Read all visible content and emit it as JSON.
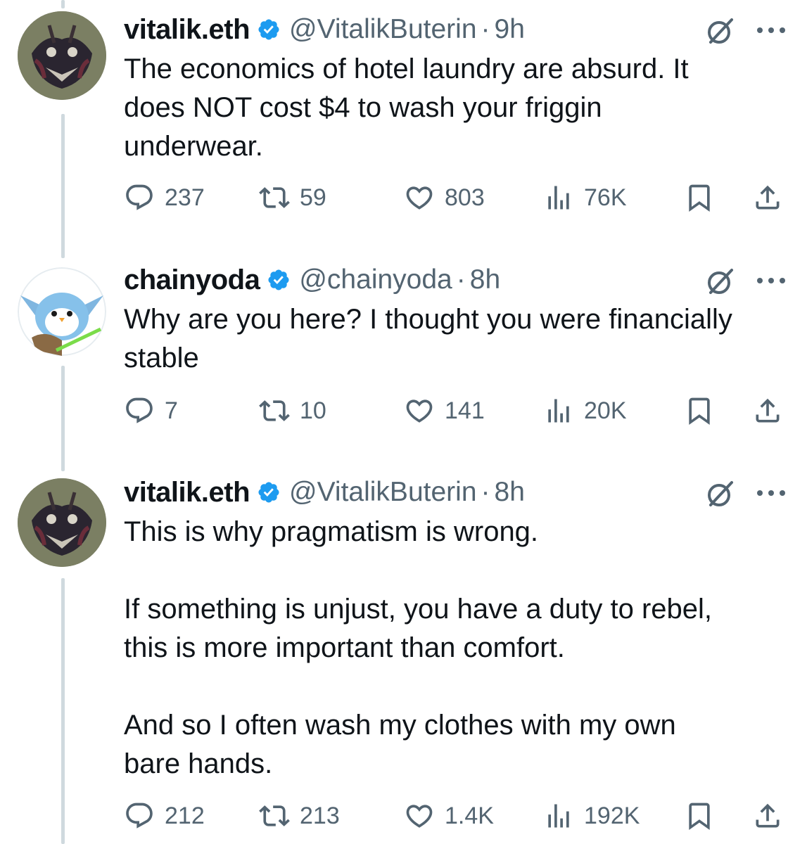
{
  "colors": {
    "verified": "#1d9bf0",
    "secondary_text": "#536471",
    "thread_line": "#cfd9de"
  },
  "tweets": [
    {
      "name": "vitalik.eth",
      "handle": "@VitalikButerin",
      "separator": "·",
      "time": "9h",
      "text": "The economics of hotel laundry are absurd. It\ndoes NOT cost $4 to wash your friggin\nunderwear.",
      "replies": "237",
      "reposts": "59",
      "likes": "803",
      "views": "76K",
      "icons": [
        "verified-badge-icon",
        "grok-icon",
        "more-icon",
        "reply-icon",
        "repost-icon",
        "like-icon",
        "views-icon",
        "bookmark-icon",
        "share-icon"
      ]
    },
    {
      "name": "chainyoda",
      "handle": "@chainyoda",
      "separator": "·",
      "time": "8h",
      "text": "Why are you here? I thought you were financially\nstable",
      "replies": "7",
      "reposts": "10",
      "likes": "141",
      "views": "20K",
      "icons": [
        "verified-badge-icon",
        "grok-icon",
        "more-icon",
        "reply-icon",
        "repost-icon",
        "like-icon",
        "views-icon",
        "bookmark-icon",
        "share-icon"
      ]
    },
    {
      "name": "vitalik.eth",
      "handle": "@VitalikButerin",
      "separator": "·",
      "time": "8h",
      "text": "This is why pragmatism is wrong.\n\nIf something is unjust, you have a duty to rebel,\nthis is more important than comfort.\n\nAnd so I often wash my clothes with my own\nbare hands.",
      "replies": "212",
      "reposts": "213",
      "likes": "1.4K",
      "views": "192K",
      "icons": [
        "verified-badge-icon",
        "grok-icon",
        "more-icon",
        "reply-icon",
        "repost-icon",
        "like-icon",
        "views-icon",
        "bookmark-icon",
        "share-icon"
      ]
    }
  ]
}
